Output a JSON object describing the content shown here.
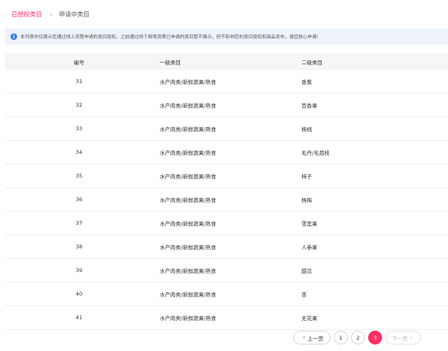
{
  "tabs": {
    "active": "已授权类目",
    "separator": "›",
    "other": "申请中类目"
  },
  "notice": {
    "icon": "i",
    "text": "本列表中仅展示您通过线上流程申请的类目授权，之前通过线下邮寄资质已申请的类目暂不展示，但不影响您的类目授权和商品发布，请您放心申请!"
  },
  "table": {
    "headers": [
      "编号",
      "一级类目",
      "二级类目"
    ],
    "rows": [
      [
        "31",
        "水产肉类/新鲜蔬果/熟食",
        "香蕉"
      ],
      [
        "32",
        "水产肉类/新鲜蔬果/熟食",
        "百香果"
      ],
      [
        "33",
        "水产肉类/新鲜蔬果/熟食",
        "杨桃"
      ],
      [
        "34",
        "水产肉类/新鲜蔬果/熟食",
        "毛丹/毛荔枝"
      ],
      [
        "35",
        "水产肉类/新鲜蔬果/熟食",
        "柿子"
      ],
      [
        "36",
        "水产肉类/新鲜蔬果/熟食",
        "杨梅"
      ],
      [
        "37",
        "水产肉类/新鲜蔬果/熟食",
        "雪莲果"
      ],
      [
        "38",
        "水产肉类/新鲜蔬果/熟食",
        "人参果"
      ],
      [
        "39",
        "水产肉类/新鲜蔬果/熟食",
        "甜瓜"
      ],
      [
        "40",
        "水产肉类/新鲜蔬果/熟食",
        "杏"
      ],
      [
        "41",
        "水产肉类/新鲜蔬果/熟食",
        "无花果"
      ]
    ]
  },
  "pagination": {
    "prev": "上一页",
    "pages": [
      "1",
      "2",
      "3"
    ],
    "current": "3",
    "next": "下一页",
    "prev_arrow": "‹",
    "next_arrow": "›"
  },
  "colors": {
    "accent": "#ff2e63",
    "info": "#3a7be0",
    "header_bg": "#f5f6f7",
    "notice_bg": "#eef3fb"
  }
}
